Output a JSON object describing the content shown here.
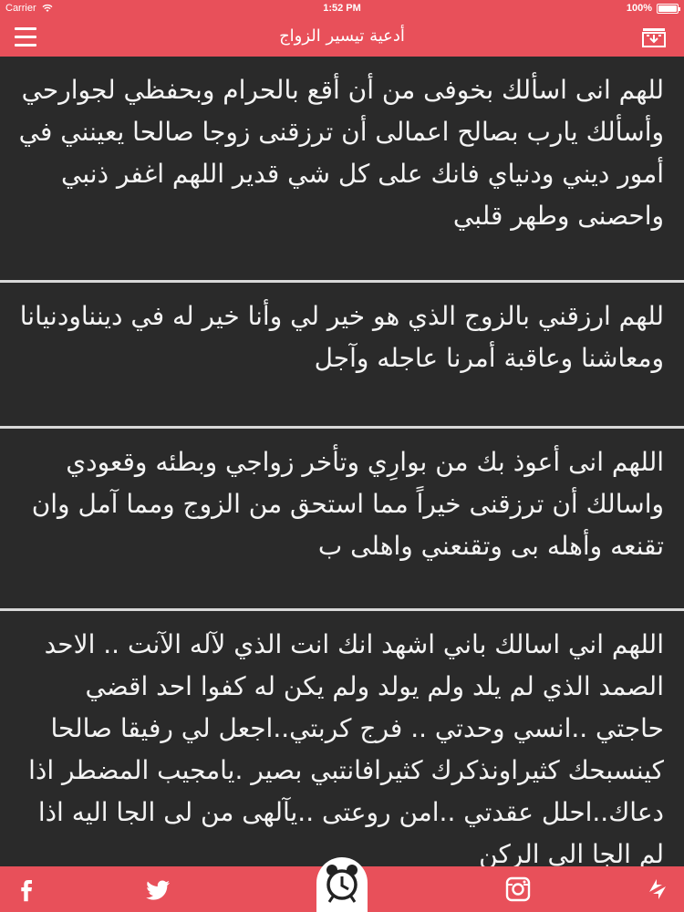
{
  "status_bar": {
    "carrier": "Carrier",
    "time": "1:52 PM",
    "battery": "100%",
    "battery_level": 1.0
  },
  "nav": {
    "title": "أدعية تيسير الزواج",
    "menu_icon": "hamburger-menu-icon",
    "share_icon": "download-share-icon"
  },
  "duas": [
    {
      "text": "للهم انى اسألك بخوفى من أن أقع بالحرام وبحفظي لجوارحي وأسألك يارب بصالح اعمالى أن ترزقنى زوجا صالحا يعينني في أمور ديني ودنياي فانك على كل شي قدير اللهم اغفر ذنبي واحصنى وطهر قلبي"
    },
    {
      "text": "للهم ارزقني بالزوج الذي هو خير لي وأنا خير له في دينناودنيانا ومعاشنا وعاقبة أمرنا عاجله وآجل"
    },
    {
      "text": "اللهم انى أعوذ بك من بوارِي وتأخر زواجي وبطئه وقعودي واسالك أن ترزقنى خيراً مما استحق من الزوج ومما آمل وان تقنعه وأهله بى وتقنعني واهلى ب"
    },
    {
      "text": "اللهم اني اسالك باني اشهد انك انت الذي لآله الآنت .. الاحد الصمد الذي لم يلد ولم يولد ولم يكن له كفوا احد اقضي حاجتي ..انسي وحدتي .. فرج كربتي..اجعل لي رفيقا صالحا كينسبحك كثيراونذكرك كثيرافانتبي بصير .يامجيب المضطر اذا دعاك..احلل عقدتي ..امن روعتى ..يآلهى من لى الجا اليه اذا لم الجا الى الركن"
    }
  ],
  "tabbar": {
    "facebook_icon": "facebook-icon",
    "twitter_icon": "twitter-icon",
    "alarm_icon": "alarm-clock-icon",
    "instagram_icon": "instagram-icon",
    "refresh_icon": "refresh-icon"
  },
  "colors": {
    "accent": "#e8505a",
    "background": "#2a2a2a",
    "text": "#f4f4f4",
    "divider": "#d8d8d8"
  }
}
